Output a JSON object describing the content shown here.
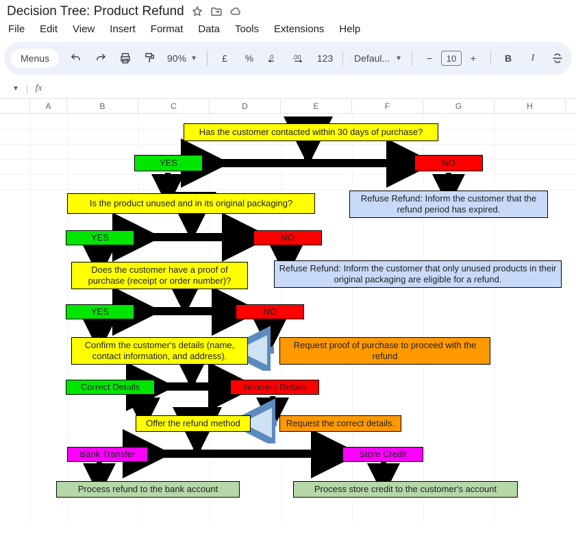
{
  "title": "Decision Tree: Product Refund",
  "menubar": {
    "file": "File",
    "edit": "Edit",
    "view": "View",
    "insert": "Insert",
    "format": "Format",
    "data": "Data",
    "tools": "Tools",
    "extensions": "Extensions",
    "help": "Help"
  },
  "toolbar": {
    "menus_label": "Menus",
    "zoom": "90%",
    "currency": "£",
    "percent": "%",
    "dec_dec": ".0",
    "dec_inc": ".00",
    "num123": "123",
    "font_name": "Defaul...",
    "font_size": "10",
    "minus": "−",
    "plus": "+",
    "bold": "B",
    "italic": "I"
  },
  "formula_bar": {
    "fx": "fx"
  },
  "columns": [
    "A",
    "B",
    "C",
    "D",
    "E",
    "F",
    "G",
    "H"
  ],
  "flow": {
    "q1": "Has the customer contacted within 30 days of purchase?",
    "yes1": "YES",
    "no1": "NO",
    "blue1": "Refuse Refund: Inform the customer that the refund period has expired.",
    "q2": "Is the product unused and in its original packaging?",
    "yes2": "YES",
    "no2": "NO",
    "blue2": "Refuse Refund: Inform the customer that only unused products in their original packaging are eligible for a refund.",
    "q3": "Does the customer have a proof of purchase (receipt or order number)?",
    "yes3": "YES",
    "no3": "NO",
    "confirm": "Confirm the customer's details (name, contact information, and address).",
    "reqproof": "Request proof of purchase to proceed with the refund",
    "correct": "Correct Details",
    "incorrect": "Incorrect Details",
    "offer": "Offer the refund method",
    "reqcorrect": "Request the correct details.",
    "bank": "Bank Transfer",
    "credit": "Store Credit",
    "procbank": "Process refund to the bank account",
    "procstore": "Process store credit to the customer's account"
  }
}
